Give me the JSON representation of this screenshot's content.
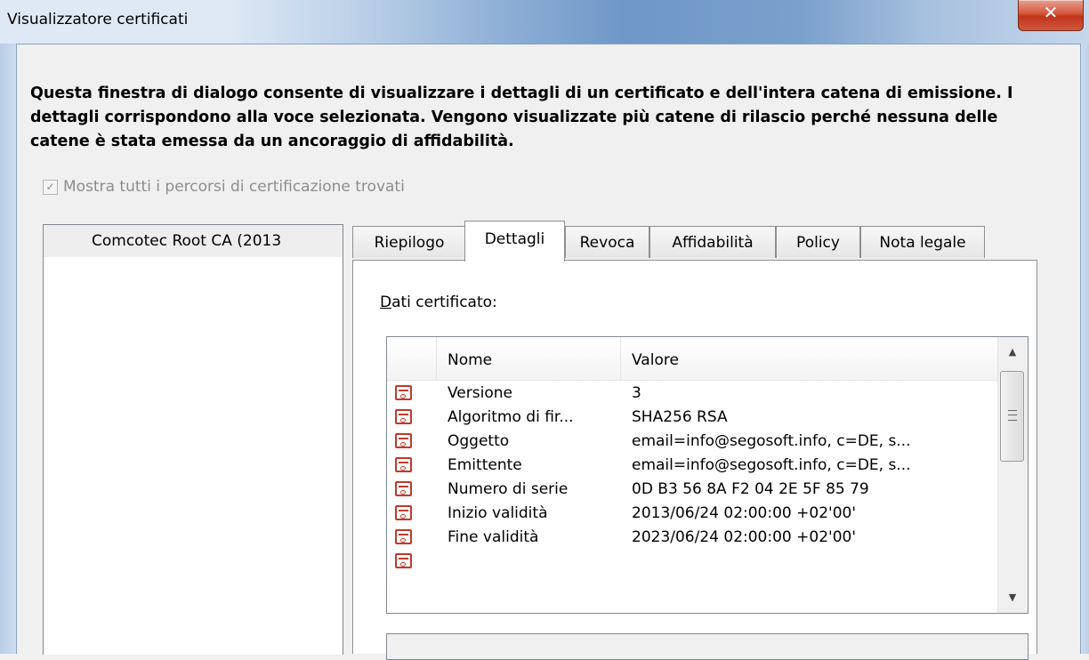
{
  "window": {
    "title": "Visualizzatore certificati",
    "close_glyph": "✕"
  },
  "intro_text": "Questa finestra di dialogo consente di visualizzare i dettagli di un certificato e dell'intera catena di emissione. I dettagli corrispondono alla voce selezionata. Vengono visualizzate più catene di rilascio perché nessuna delle catene è stata emessa da un ancoraggio di affidabilità.",
  "show_all_paths": {
    "label": "Mostra tutti i percorsi di certificazione trovati",
    "checked": true,
    "enabled": false
  },
  "tree": {
    "items": [
      {
        "label": "Comcotec Root CA (2013",
        "selected": true
      }
    ]
  },
  "tabs": [
    {
      "label": "Riepilogo",
      "active": false
    },
    {
      "label": "Dettagli",
      "active": true
    },
    {
      "label": "Revoca",
      "active": false
    },
    {
      "label": "Affidabilità",
      "active": false
    },
    {
      "label": "Policy",
      "active": false
    },
    {
      "label": "Nota legale",
      "active": false
    }
  ],
  "details": {
    "label_accel": "D",
    "label_rest": "ati certificato:",
    "columns": {
      "name": "Nome",
      "value": "Valore"
    },
    "rows": [
      {
        "icon": "certificate-field-icon",
        "name": "Versione",
        "value": "3"
      },
      {
        "icon": "certificate-field-icon",
        "name": "Algoritmo di fir...",
        "value": "SHA256 RSA"
      },
      {
        "icon": "certificate-field-icon",
        "name": "Oggetto",
        "value": "email=info@segosoft.info, c=DE, s..."
      },
      {
        "icon": "certificate-field-icon",
        "name": "Emittente",
        "value": "email=info@segosoft.info, c=DE, s..."
      },
      {
        "icon": "certificate-field-icon",
        "name": "Numero di serie",
        "value": "0D B3 56 8A F2 04 2E 5F 85 79"
      },
      {
        "icon": "certificate-field-icon",
        "name": "Inizio validità",
        "value": "2013/06/24 02:00:00 +02'00'"
      },
      {
        "icon": "certificate-field-icon",
        "name": "Fine validità",
        "value": "2023/06/24 02:00:00 +02'00'"
      }
    ],
    "scroll": {
      "up_glyph": "▲",
      "down_glyph": "▼"
    }
  }
}
